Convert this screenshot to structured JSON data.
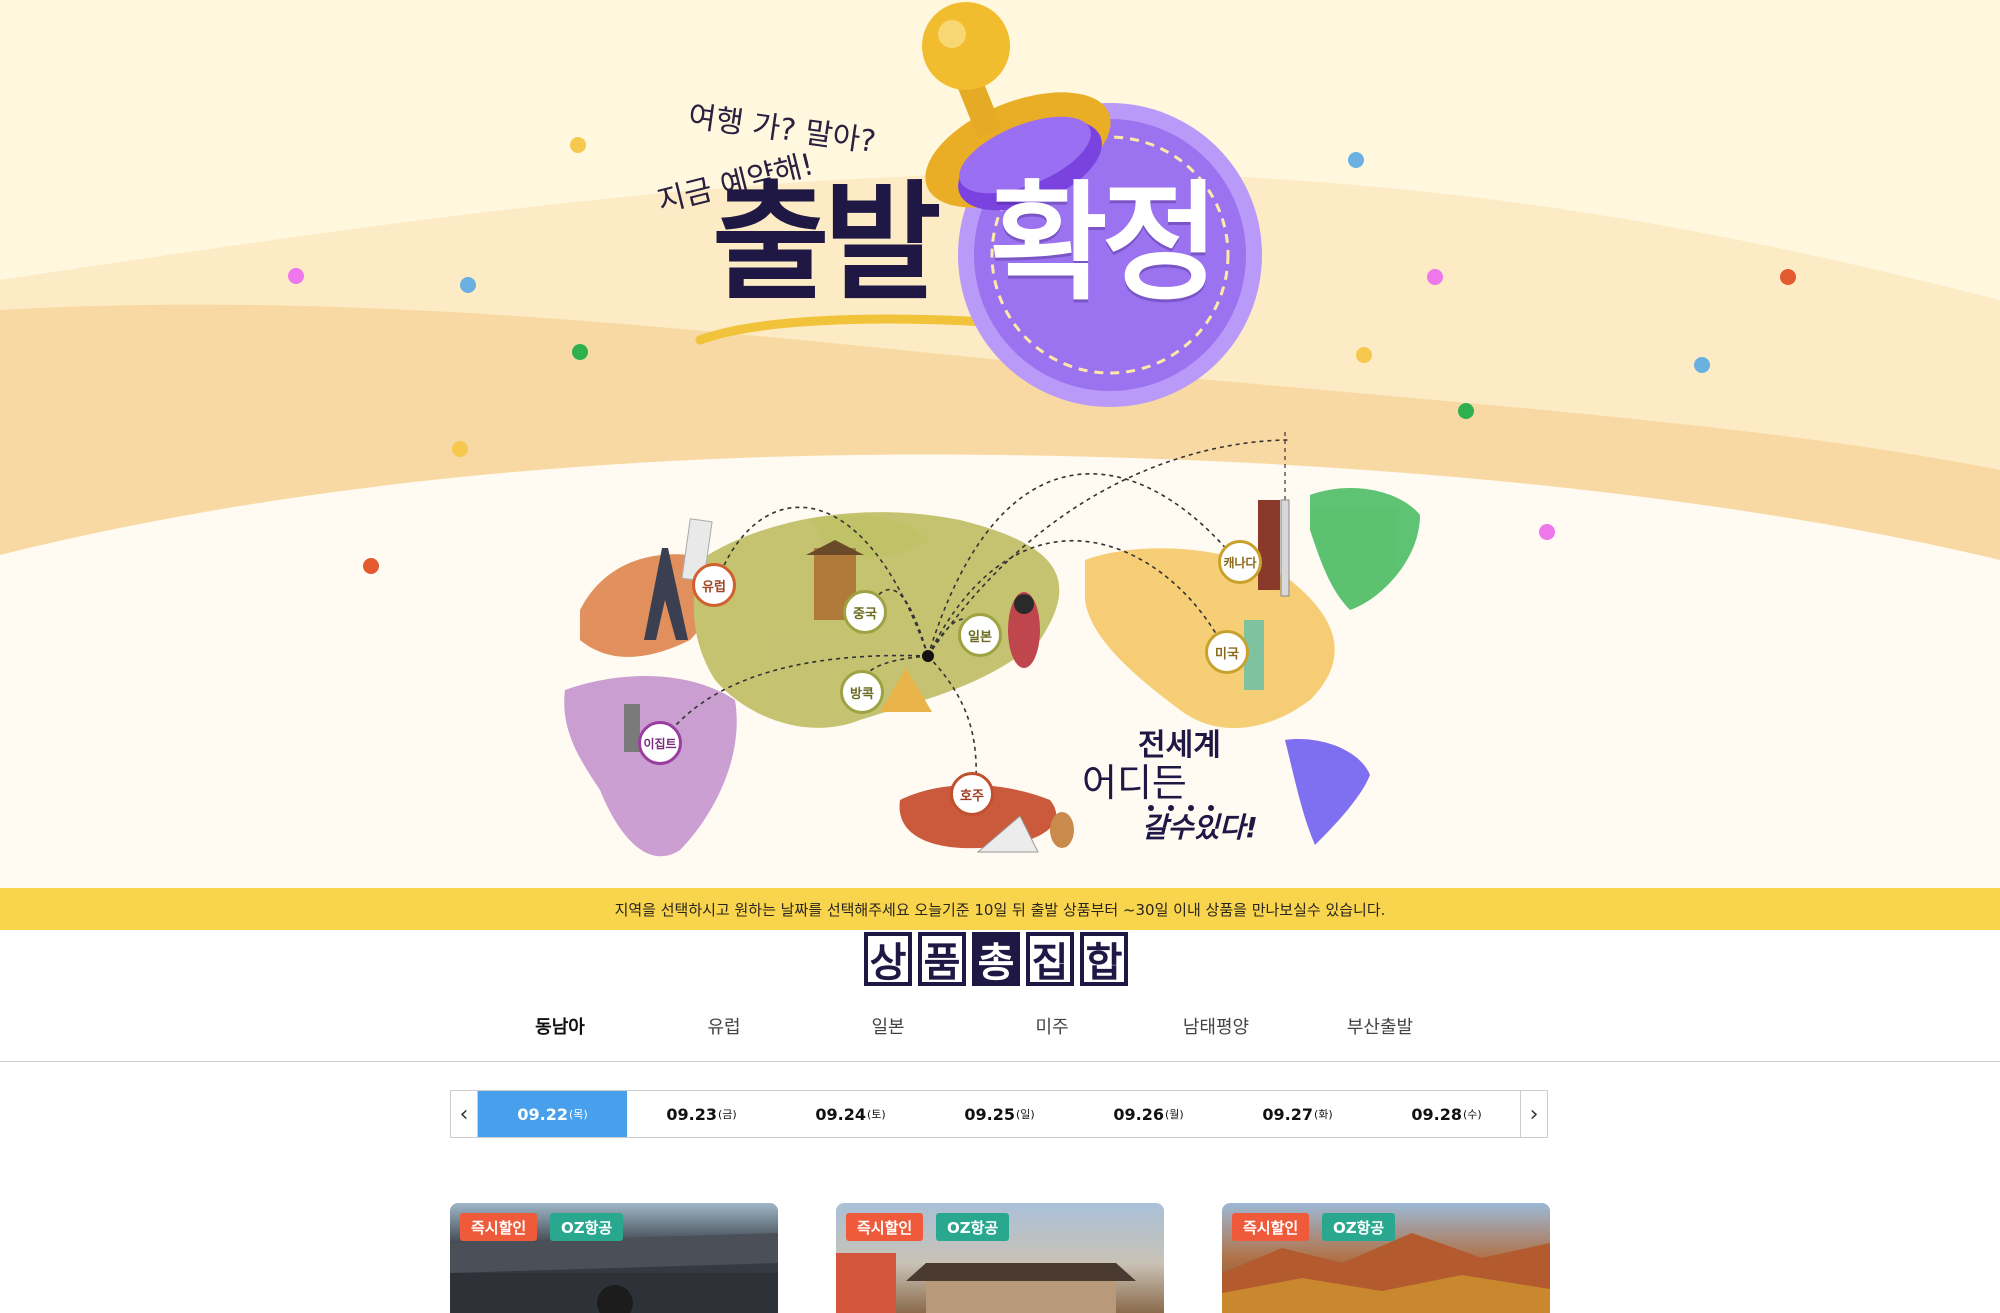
{
  "hero": {
    "tagline_1": "여행 가? 말아?",
    "tagline_2": "지금 예약해!",
    "title_dark": "출발",
    "title_white": "확정",
    "map_labels": [
      {
        "name": "europe",
        "text": "유럽",
        "color": "#d0602e"
      },
      {
        "name": "china",
        "text": "중국",
        "color": "#8a8a2e"
      },
      {
        "name": "japan",
        "text": "일본",
        "color": "#8a8a2e"
      },
      {
        "name": "bangkok",
        "text": "방콕",
        "color": "#8a8a2e"
      },
      {
        "name": "egypt",
        "text": "이집트",
        "color": "#9a3ea0"
      },
      {
        "name": "australia",
        "text": "호주",
        "color": "#c0502e"
      },
      {
        "name": "canada",
        "text": "캐나다",
        "color": "#c9a22e"
      },
      {
        "name": "usa",
        "text": "미국",
        "color": "#c9a22e"
      }
    ],
    "slogan_1": "전세계",
    "slogan_2": "어디든",
    "slogan_3": "갈수있다!"
  },
  "info_bar": {
    "text": "지역을 선택하시고 원하는 날짜를 선택해주세요 오늘기준 10일 뒤 출발 상품부터 ~30일 이내 상품을 만나보실수 있습니다."
  },
  "section": {
    "title_chars": [
      "상",
      "품",
      "총",
      "집",
      "합"
    ]
  },
  "tabs": [
    {
      "label": "동남아",
      "active": true
    },
    {
      "label": "유럽",
      "active": false
    },
    {
      "label": "일본",
      "active": false
    },
    {
      "label": "미주",
      "active": false
    },
    {
      "label": "남태평양",
      "active": false
    },
    {
      "label": "부산출발",
      "active": false
    }
  ],
  "dates": [
    {
      "date": "09.22",
      "day": "(목)",
      "active": true
    },
    {
      "date": "09.23",
      "day": "(금)",
      "active": false
    },
    {
      "date": "09.24",
      "day": "(토)",
      "active": false
    },
    {
      "date": "09.25",
      "day": "(일)",
      "active": false
    },
    {
      "date": "09.26",
      "day": "(월)",
      "active": false
    },
    {
      "date": "09.27",
      "day": "(화)",
      "active": false
    },
    {
      "date": "09.28",
      "day": "(수)",
      "active": false
    }
  ],
  "date_nav": {
    "prev": "‹",
    "next": "›"
  },
  "cards": [
    {
      "badge_1": "즉시할인",
      "badge_2": "OZ항공"
    },
    {
      "badge_1": "즉시할인",
      "badge_2": "OZ항공"
    },
    {
      "badge_1": "즉시할인",
      "badge_2": "OZ항공"
    }
  ],
  "colors": {
    "hero_bg": "#fff8df",
    "band_light": "#fce5b4",
    "band_dark": "#f9d9a3",
    "info_bar": "#f8d54c",
    "active_date": "#48a0ec",
    "badge_red": "#ef5a3a",
    "badge_teal": "#2aa88f",
    "stamp_purple": "#9b73f0",
    "title_navy": "#1f1845"
  }
}
